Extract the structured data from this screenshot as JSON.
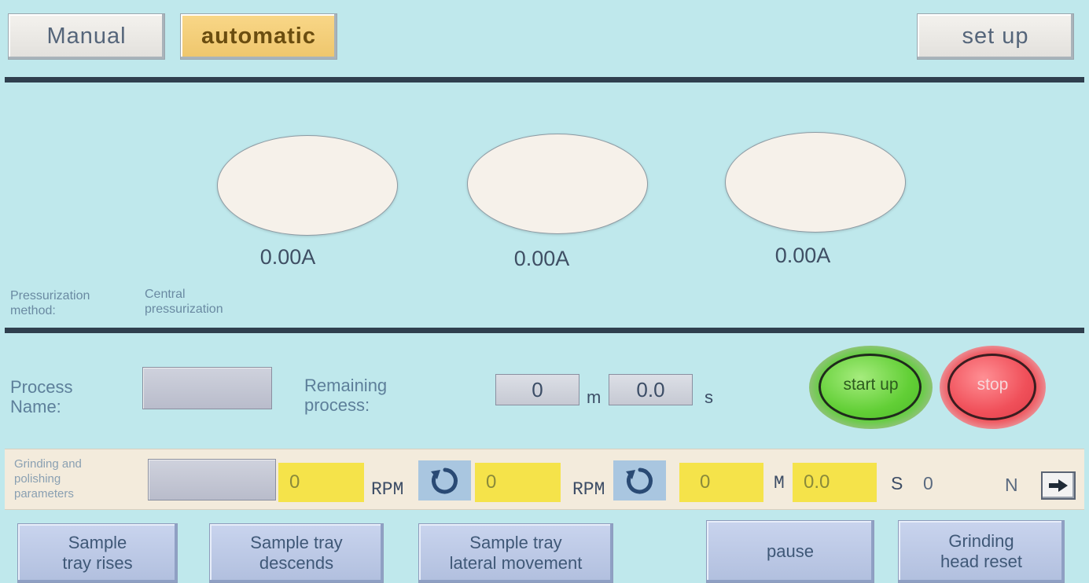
{
  "header": {
    "manual_label": "Manual",
    "automatic_label": "automatic",
    "setup_label": "set up"
  },
  "gauges": [
    {
      "value": "0.00A"
    },
    {
      "value": "0.00A"
    },
    {
      "value": "0.00A"
    }
  ],
  "pressurization": {
    "label_line1": "Pressurization",
    "label_line2": "method:",
    "value_line1": "Central",
    "value_line2": "pressurization"
  },
  "process": {
    "name_label_line1": "Process",
    "name_label_line2": "Name:",
    "name_value": "",
    "remaining_line1": "Remaining",
    "remaining_line2": "process:",
    "minutes_value": "0",
    "minutes_unit": "m",
    "seconds_value": "0.0",
    "seconds_unit": "s",
    "start_label": "start up",
    "stop_label": "stop"
  },
  "params": {
    "label_line1": "Grinding and",
    "label_line2": "polishing",
    "label_line3": "parameters",
    "name_value": "",
    "rpm1_value": "0",
    "rpm1_unit": "RPM",
    "rpm2_value": "0",
    "rpm2_unit": "RPM",
    "minutes_value": "0",
    "minutes_unit": "M",
    "seconds_value": "0.0",
    "seconds_unit": "S",
    "force_value": "0",
    "force_unit": "N"
  },
  "bottom_buttons": {
    "rise_line1": "Sample",
    "rise_line2": "tray rises",
    "descend_line1": "Sample tray",
    "descend_line2": "descends",
    "lateral_line1": "Sample tray",
    "lateral_line2": "lateral movement",
    "pause_label": "pause",
    "reset_line1": "Grinding",
    "reset_line2": "head reset"
  },
  "colors": {
    "background": "#bfe8ec",
    "active_button": "#f0c86f",
    "start_button": "#5fcf3a",
    "stop_button": "#f0505a",
    "param_field": "#f5e34a"
  }
}
